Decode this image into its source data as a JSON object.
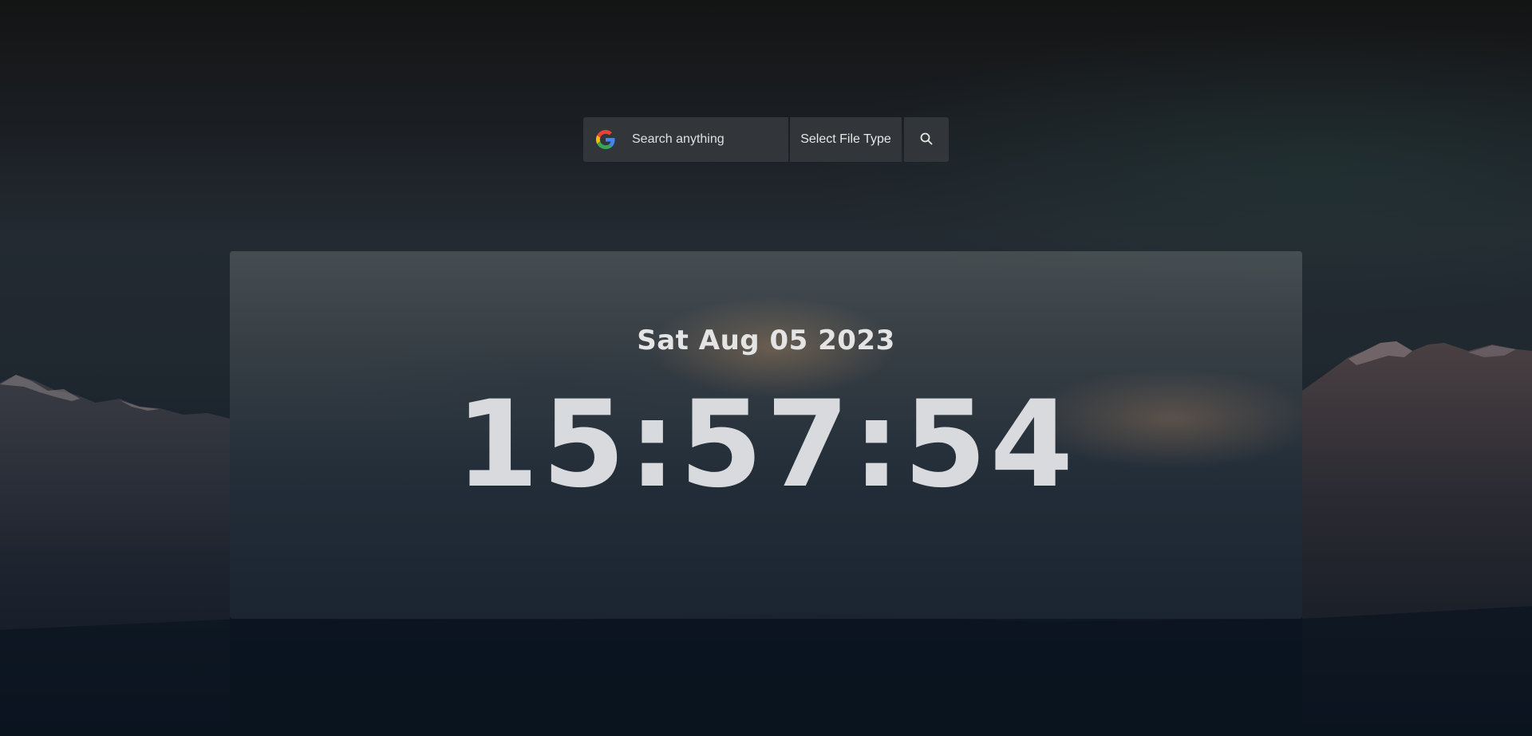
{
  "search": {
    "placeholder": "Search anything",
    "value": "",
    "provider_icon": "google-g-icon",
    "filetype_label": "Select File Type",
    "submit_icon": "search-icon"
  },
  "clock": {
    "date": "Sat Aug 05 2023",
    "time": "15:57:54"
  },
  "colors": {
    "bar_bg": "#34383c",
    "text": "#e4e4e4",
    "clock_text": "#d8dadd"
  }
}
